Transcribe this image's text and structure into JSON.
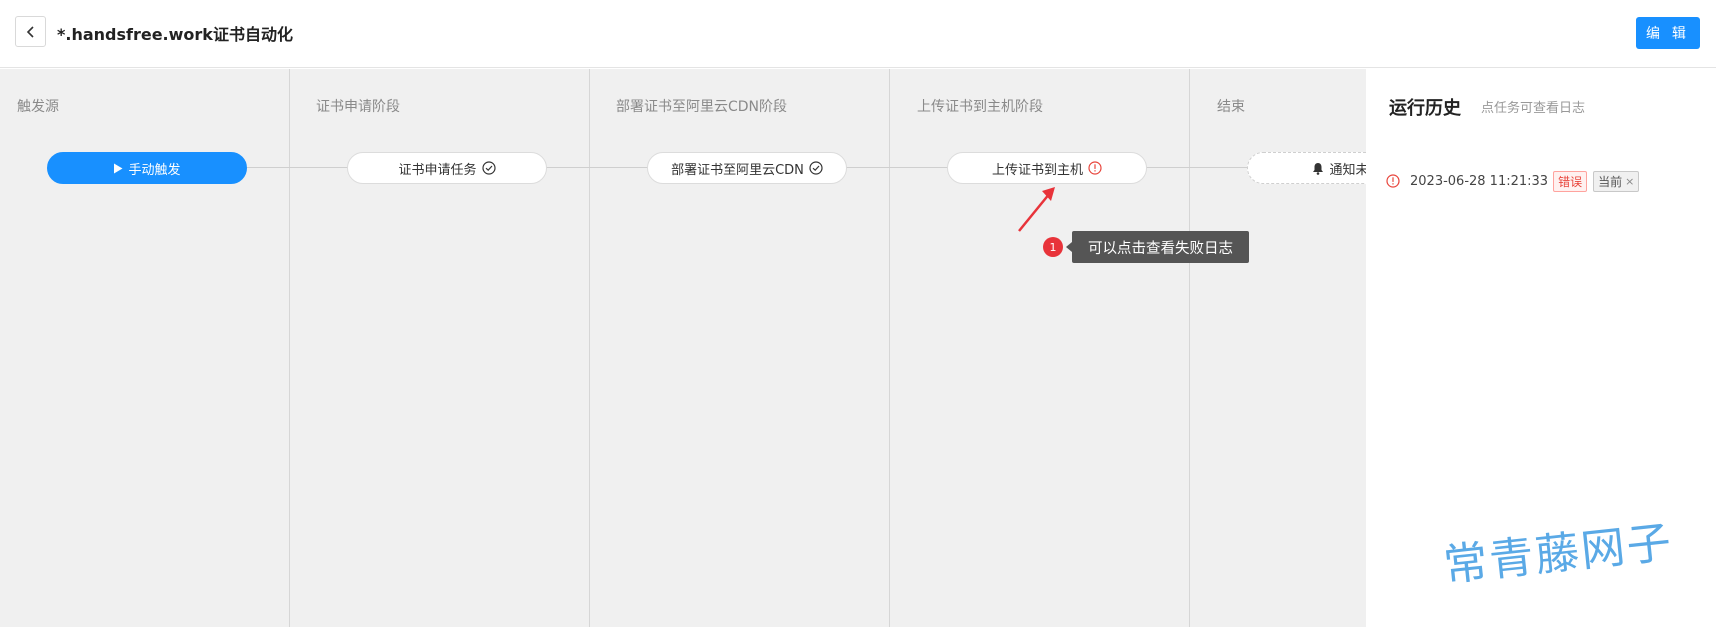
{
  "header": {
    "title": "*.handsfree.work证书自动化",
    "edit_label": "编 辑",
    "back_icon": "chevron-left-icon"
  },
  "pipeline": {
    "stages": [
      {
        "title": "触发源",
        "node_label": "手动触发",
        "node_kind": "trigger",
        "status_icon": "play-icon"
      },
      {
        "title": "证书申请阶段",
        "node_label": "证书申请任务",
        "node_kind": "task",
        "status_icon": "check-circle-icon",
        "status_color": "#333333"
      },
      {
        "title": "部署证书至阿里云CDN阶段",
        "node_label": "部署证书至阿里云CDN",
        "node_kind": "task",
        "status_icon": "check-circle-icon",
        "status_color": "#333333"
      },
      {
        "title": "上传证书到主机阶段",
        "node_label": "上传证书到主机",
        "node_kind": "task",
        "status_icon": "error-circle-icon",
        "status_color": "#e8453c"
      },
      {
        "title": "结束",
        "node_label": "通知未设",
        "node_kind": "notify",
        "status_icon": "bell-icon"
      }
    ]
  },
  "callout": {
    "badge": "1",
    "text": "可以点击查看失败日志"
  },
  "history": {
    "title": "运行历史",
    "subtitle": "点任务可查看日志",
    "items": [
      {
        "time": "2023-06-28 11:21:33",
        "status": "错误",
        "tag": "当前",
        "close": "×",
        "status_color": "#e8453c"
      }
    ]
  },
  "watermark": "常青藤网子",
  "colors": {
    "accent": "#1890ff",
    "error": "#e8453c",
    "canvas_bg": "#f0f0f0"
  }
}
